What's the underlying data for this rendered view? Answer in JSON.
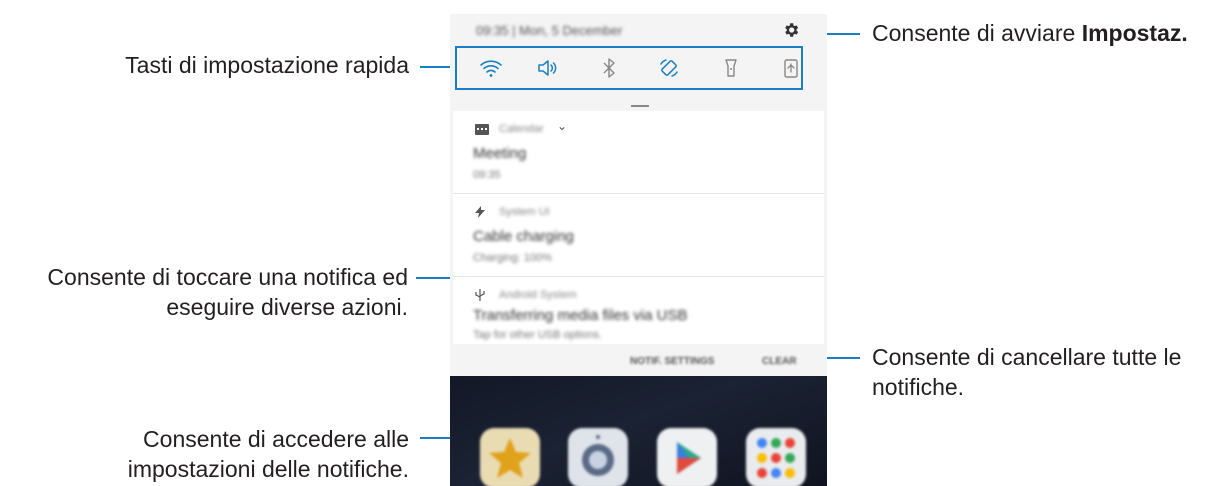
{
  "callouts": {
    "quick_settings": "Tasti di impostazione rapida",
    "settings_prefix": "Consente di avviare ",
    "settings_bold": "Impostaz.",
    "notification_line1": "Consente di toccare una notifica ed",
    "notification_line2": "eseguire diverse azioni.",
    "clear_line1": "Consente di cancellare tutte le",
    "clear_line2": "notifiche.",
    "notif_settings_line1": "Consente di accedere alle",
    "notif_settings_line2": "impostazioni delle notifiche."
  },
  "phone": {
    "status_text": "09:35 | Mon, 5 December",
    "notifications": [
      {
        "app": "Calendar",
        "title": "Meeting",
        "sub": "09:35"
      },
      {
        "app": "System UI",
        "title": "Cable charging",
        "sub": "Charging: 100%"
      },
      {
        "app": "Android System",
        "title": "Transferring media files via USB",
        "sub": "Tap for other USB options."
      }
    ],
    "notif_settings_label": "NOTIF. SETTINGS",
    "clear_label": "CLEAR"
  },
  "colors": {
    "accent": "#1a7fc1",
    "text": "#231f20",
    "panel": "#f4f4f4"
  },
  "icons": [
    "gear-icon",
    "wifi-icon",
    "sound-icon",
    "bluetooth-icon",
    "auto-rotate-icon",
    "flashlight-icon",
    "airplane-icon",
    "calendar-icon",
    "charging-icon",
    "usb-icon",
    "star-app-icon",
    "camera-app-icon",
    "play-store-app-icon",
    "google-folder-icon"
  ]
}
